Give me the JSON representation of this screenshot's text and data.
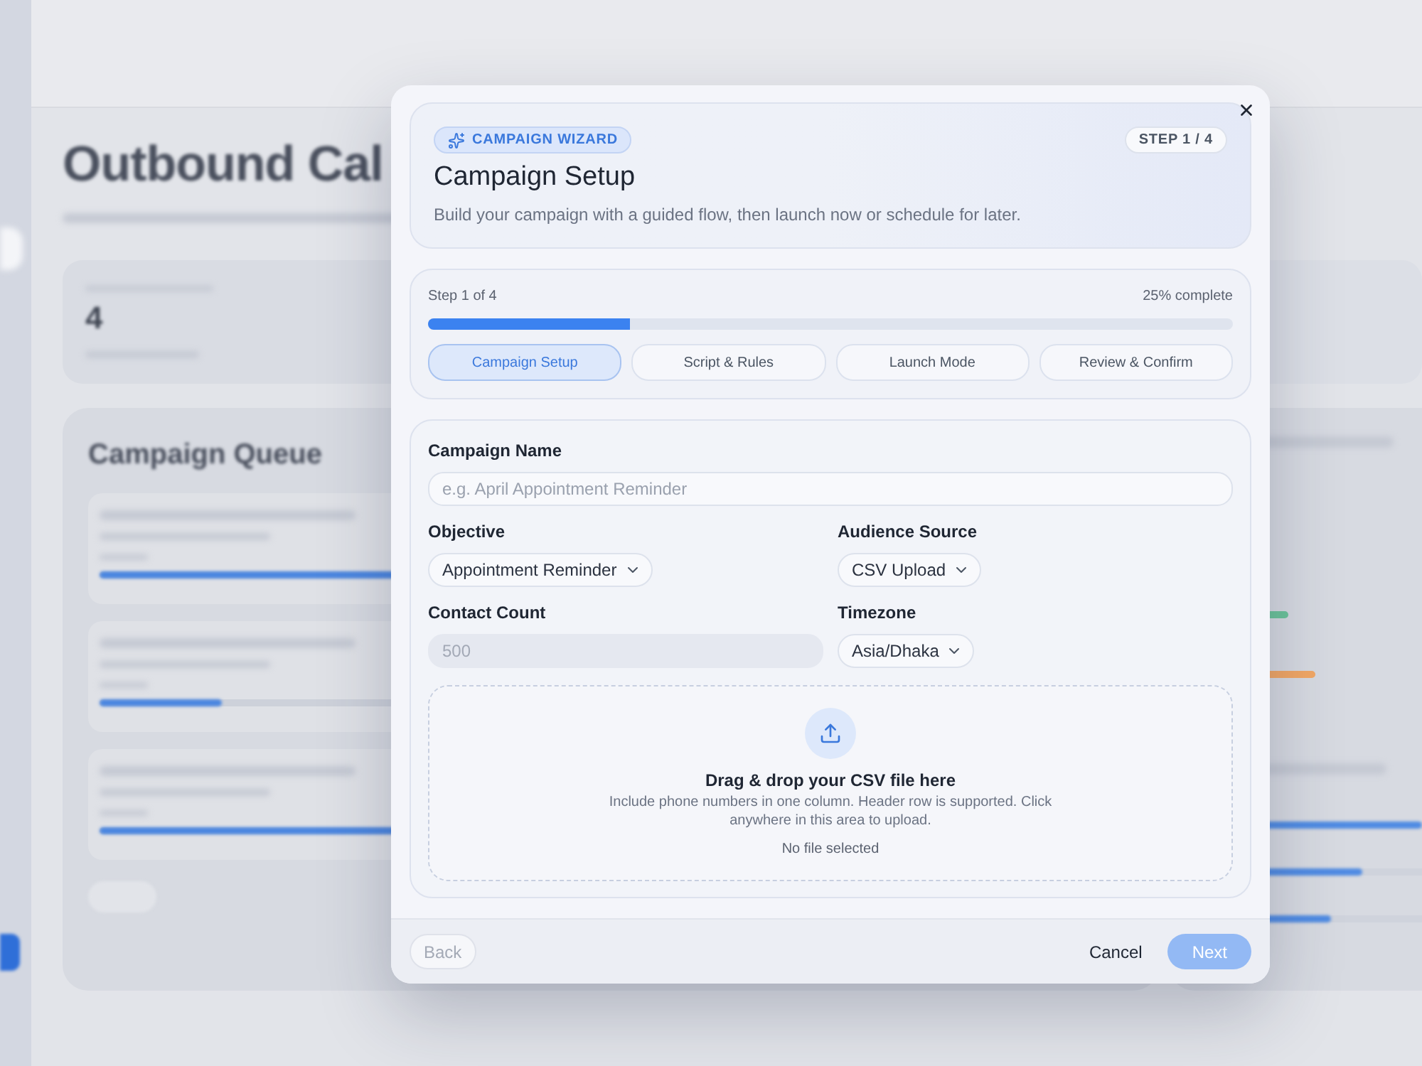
{
  "backdrop": {
    "page_title": "Outbound Cal",
    "stats": [
      {
        "value": "4"
      }
    ],
    "queue_title": "Campaign Queue",
    "queue_items": [
      {
        "level": 0.6
      },
      {
        "level": 0.12
      },
      {
        "level": 0.4
      }
    ],
    "monitor_statuses": [
      {
        "color": "#6cc49a"
      },
      {
        "color": "#f2a765"
      }
    ],
    "distribution": [
      {
        "level": 1
      },
      {
        "level": 0.74
      },
      {
        "level": 0.6
      }
    ]
  },
  "dialog": {
    "badge": "CAMPAIGN WIZARD",
    "step_badge": "STEP 1 / 4",
    "title": "Campaign Setup",
    "subtitle": "Build your campaign with a guided flow, then launch now or schedule for later.",
    "progress": {
      "label": "Step 1 of 4",
      "reading": "25% complete",
      "level": 0.25
    },
    "steps": [
      {
        "label": "Campaign Setup",
        "selected": true
      },
      {
        "label": "Script & Rules",
        "selected": false
      },
      {
        "label": "Launch Mode",
        "selected": false
      },
      {
        "label": "Review & Confirm",
        "selected": false
      }
    ],
    "fields": [
      {
        "kind": "text",
        "label": "Campaign Name",
        "placeholder": "e.g. April Appointment Reminder",
        "disabled": false
      },
      {
        "kind": "select",
        "label": "Objective",
        "value": "Appointment Reminder"
      },
      {
        "kind": "select",
        "label": "Audience Source",
        "value": "CSV Upload"
      },
      {
        "kind": "text",
        "label": "Contact Count",
        "value": "500",
        "disabled": true
      },
      {
        "kind": "select",
        "label": "Timezone",
        "value": "Asia/Dhaka"
      }
    ],
    "upload": {
      "title": "Drag & drop your CSV file here",
      "description": "Include phone numbers in one column. Header row is supported. Click anywhere in this area to upload.",
      "status": "No file selected"
    },
    "buttons": [
      {
        "kind": "back",
        "label": "Back",
        "disabled": true
      },
      {
        "kind": "cancel",
        "label": "Cancel",
        "disabled": false
      },
      {
        "kind": "primary",
        "label": "Next",
        "disabled": true
      }
    ]
  }
}
